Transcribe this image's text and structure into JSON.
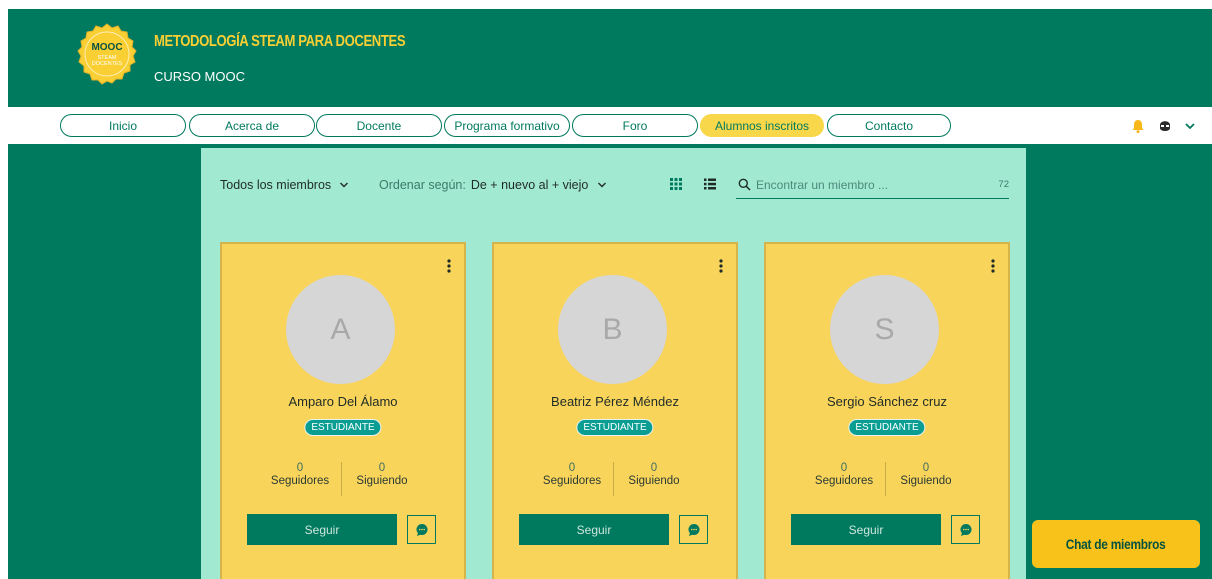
{
  "header": {
    "logo": {
      "line1": "MOOC",
      "line2": "STEAM",
      "line3": "DOCENTES"
    },
    "title": "METODOLOGÍA STEAM PARA DOCENTES",
    "subtitle": "CURSO MOOC"
  },
  "nav": {
    "items": [
      {
        "label": "Inicio"
      },
      {
        "label": "Acerca de"
      },
      {
        "label": "Docente"
      },
      {
        "label": "Programa formativo"
      },
      {
        "label": "Foro"
      },
      {
        "label": "Alumnos inscritos",
        "active": true
      },
      {
        "label": "Contacto"
      }
    ],
    "icons": [
      "bell-icon",
      "user-avatar-icon",
      "chevron-down-icon"
    ]
  },
  "toolbar": {
    "filter_label": "Todos los miembros",
    "sort_prefix": "Ordenar según:",
    "sort_value": "De + nuevo al + viejo",
    "view_icons": [
      "grid-view-icon",
      "list-view-icon"
    ],
    "search_placeholder": "Encontrar un miembro ...",
    "member_count": "72"
  },
  "members": [
    {
      "initial": "A",
      "name": "Amparo Del Álamo",
      "role": "ESTUDIANTE",
      "followers": "0",
      "followers_label": "Seguidores",
      "following": "0",
      "following_label": "Siguiendo",
      "follow_label": "Seguir"
    },
    {
      "initial": "B",
      "name": "Beatriz Pérez Méndez",
      "role": "ESTUDIANTE",
      "followers": "0",
      "followers_label": "Seguidores",
      "following": "0",
      "following_label": "Siguiendo",
      "follow_label": "Seguir"
    },
    {
      "initial": "S",
      "name": "Sergio Sánchez cruz",
      "role": "ESTUDIANTE",
      "followers": "0",
      "followers_label": "Seguidores",
      "following": "0",
      "following_label": "Siguiendo",
      "follow_label": "Seguir"
    }
  ],
  "chat": {
    "label": "Chat de miembros"
  },
  "colors": {
    "brand_green": "#007a5e",
    "brand_yellow": "#f9cf34",
    "panel_mint": "#a2e9d2",
    "card_yellow": "#f9d45a",
    "badge_teal": "#0a9e93"
  }
}
